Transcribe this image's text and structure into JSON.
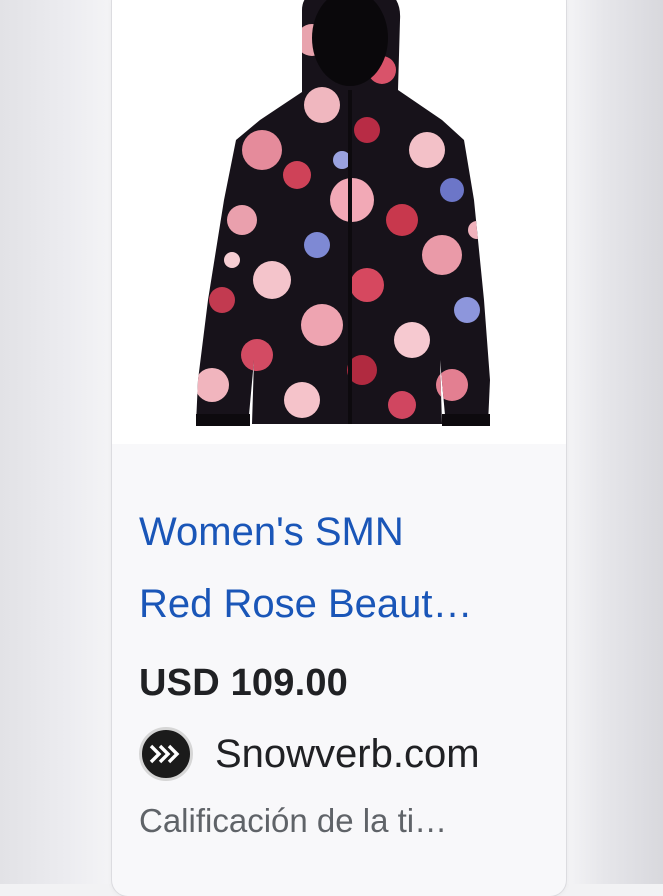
{
  "product": {
    "title_line1": "Women's SMN",
    "title_line2": "Red Rose Beaut…",
    "price": "USD 109.00",
    "image_alt": "Women's floral ski jacket"
  },
  "seller": {
    "name": "Snowverb.com",
    "logo_icon": "chevrons-right-icon"
  },
  "rating": {
    "text": "Calificación de la ti…"
  },
  "colors": {
    "link_blue": "#1a56b8",
    "price_text": "#202124",
    "secondary_text": "#5f6368"
  }
}
